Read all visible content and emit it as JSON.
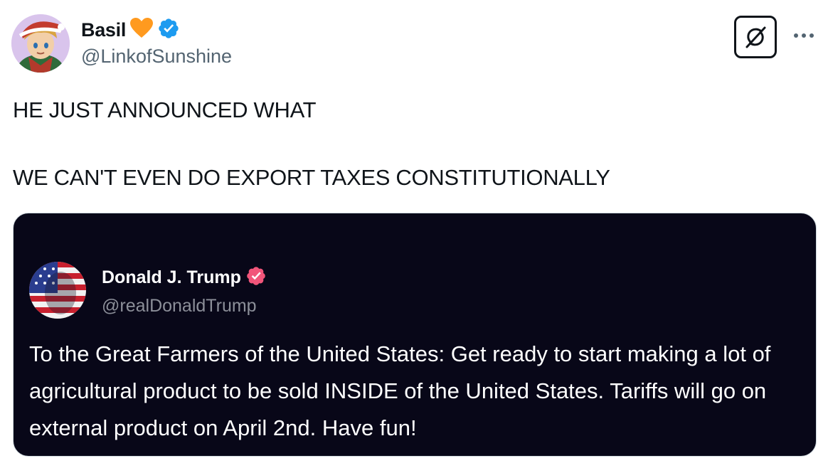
{
  "author": {
    "display_name": "Basil",
    "handle": "@LinkofSunshine",
    "name_emoji": "orange-heart-icon",
    "verified_icon": "verified-badge-icon"
  },
  "toolbar": {
    "grok_icon": "grok-icon",
    "more_icon": "more-options-icon"
  },
  "tweet": {
    "line1": "HE JUST ANNOUNCED WHAT",
    "line2": "WE CAN'T EVEN DO EXPORT TAXES CONSTITUTIONALLY"
  },
  "quoted_post": {
    "display_name": "Donald J. Trump",
    "handle": "@realDonaldTrump",
    "verified_icon": "verified-badge-icon",
    "text": "To the Great Farmers of the United States: Get ready to start making a lot of agricultural product to be sold INSIDE of the United States. Tariffs will go on external product on April 2nd. Have fun!"
  },
  "colors": {
    "verified_blue": "#1d9bf0",
    "truth_verified": "#f1557a",
    "quote_background": "#080718",
    "heart_orange": "#ff9a1f"
  }
}
